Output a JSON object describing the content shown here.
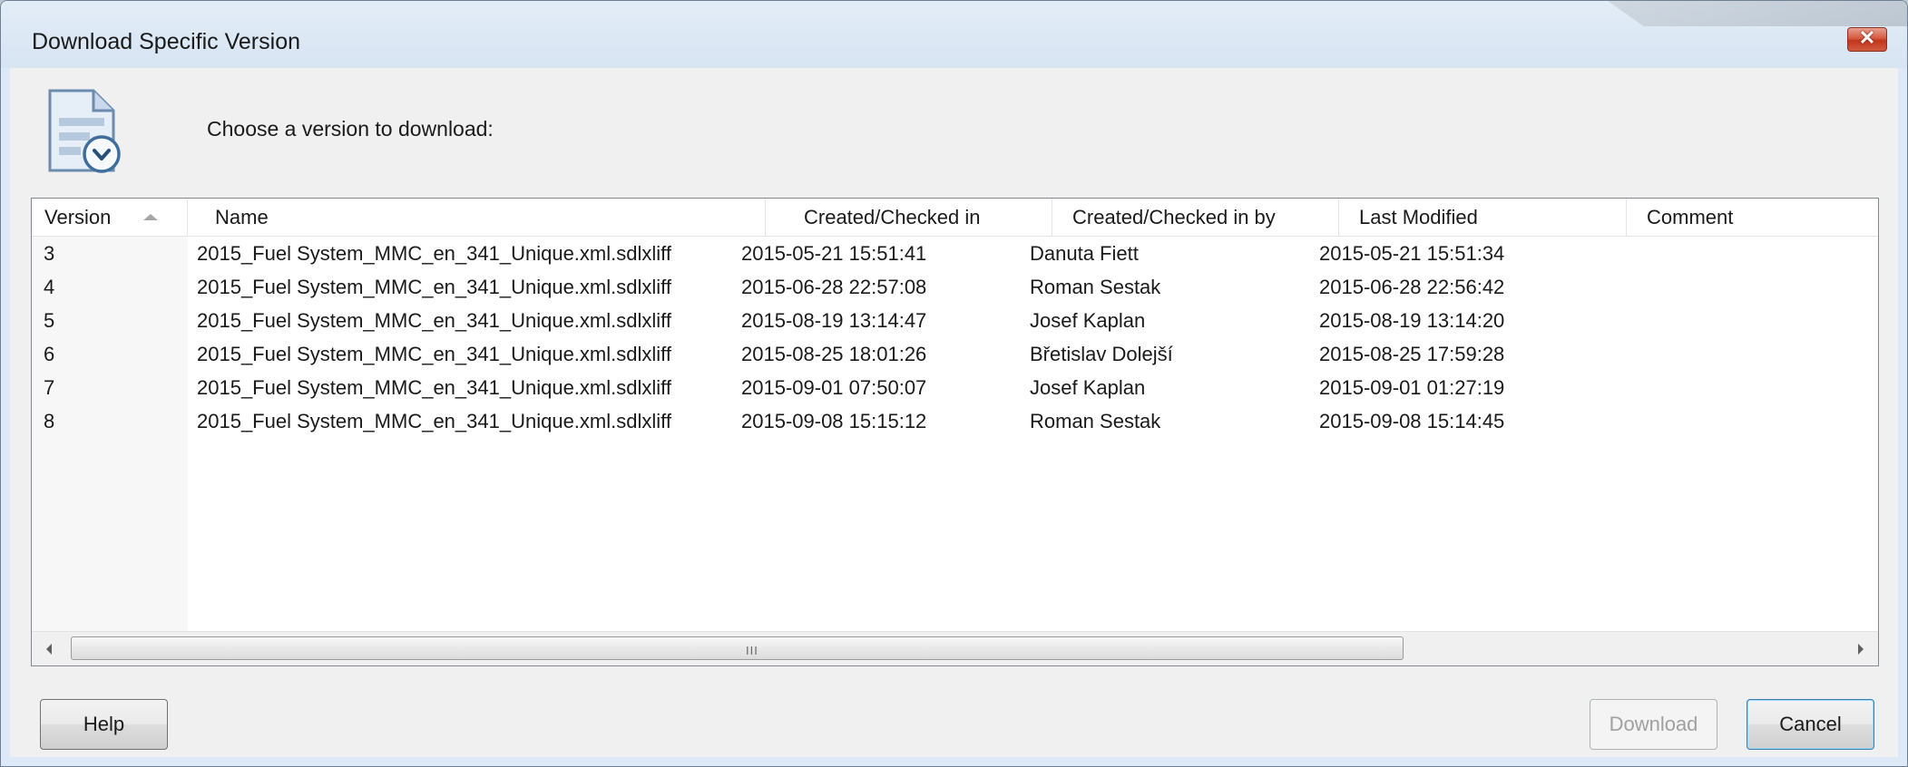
{
  "window": {
    "title": "Download Specific Version",
    "close_label": "✕"
  },
  "prompt": "Choose a version to download:",
  "table": {
    "columns": [
      {
        "label": "Version"
      },
      {
        "label": "Name"
      },
      {
        "label": "Created/Checked in"
      },
      {
        "label": "Created/Checked in by"
      },
      {
        "label": "Last Modified"
      },
      {
        "label": "Comment"
      }
    ],
    "sorted_column": "Version",
    "sort_direction": "ascending",
    "rows": [
      {
        "version": "3",
        "name": "2015_Fuel  System_MMC_en_341_Unique.xml.sdlxliff",
        "created": "2015-05-21 15:51:41",
        "created_by": "Danuta Fiett",
        "last_modified": "2015-05-21 15:51:34",
        "comment": ""
      },
      {
        "version": "4",
        "name": "2015_Fuel  System_MMC_en_341_Unique.xml.sdlxliff",
        "created": "2015-06-28 22:57:08",
        "created_by": "Roman Sestak",
        "last_modified": "2015-06-28 22:56:42",
        "comment": ""
      },
      {
        "version": "5",
        "name": "2015_Fuel  System_MMC_en_341_Unique.xml.sdlxliff",
        "created": "2015-08-19 13:14:47",
        "created_by": "Josef Kaplan",
        "last_modified": "2015-08-19 13:14:20",
        "comment": ""
      },
      {
        "version": "6",
        "name": "2015_Fuel  System_MMC_en_341_Unique.xml.sdlxliff",
        "created": "2015-08-25 18:01:26",
        "created_by": "Břetislav Dolejší",
        "last_modified": "2015-08-25 17:59:28",
        "comment": ""
      },
      {
        "version": "7",
        "name": "2015_Fuel  System_MMC_en_341_Unique.xml.sdlxliff",
        "created": "2015-09-01 07:50:07",
        "created_by": "Josef Kaplan",
        "last_modified": "2015-09-01 01:27:19",
        "comment": ""
      },
      {
        "version": "8",
        "name": "2015_Fuel  System_MMC_en_341_Unique.xml.sdlxliff",
        "created": "2015-09-08 15:15:12",
        "created_by": "Roman Sestak",
        "last_modified": "2015-09-08 15:14:45",
        "comment": ""
      }
    ]
  },
  "scrollbar": {
    "grip": "III"
  },
  "buttons": {
    "help": "Help",
    "download": "Download",
    "cancel": "Cancel"
  },
  "icons": {
    "dialog_icon": "document-download-icon",
    "close": "close-icon"
  }
}
